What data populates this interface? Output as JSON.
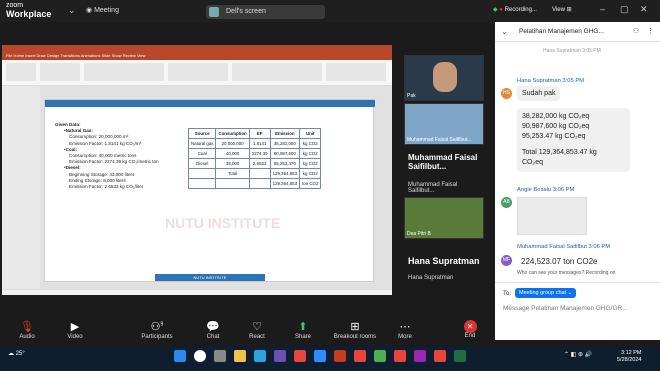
{
  "app": {
    "brand_top": "zoom",
    "brand_bottom": "Workplace",
    "meeting_label": "Meeting"
  },
  "share_bar": {
    "label": "Dell's screen"
  },
  "status": {
    "recording": "Recording...",
    "view": "View"
  },
  "slide": {
    "given_title": "Given Data:",
    "natural_gas": {
      "title": "•Natural Gas:",
      "consumption": "Consumption: 20,000,000 m³",
      "ef": "Emission Factor: 1.8141 kg CO₂/m³"
    },
    "coal": {
      "title": "•Coal:",
      "consumption": "Consumption: 40,000 metric tons",
      "ef": "Emission Factor: 2274.39 kg CO₂/metric ton"
    },
    "diesel": {
      "title": "•Diesel:",
      "beginning": "Beginning Storage: 43,000 liters",
      "ending": "Ending Storage: 8,000 liters",
      "ef": "Emission Factor: 2.6533 kg CO₂/liter"
    },
    "table": {
      "headers": [
        "Source",
        "Consumption",
        "EF",
        "Emission",
        "Unit"
      ],
      "rows": [
        [
          "Natural gas",
          "20,000,000",
          "1.8141",
          "36,282,000",
          "kg CO2"
        ],
        [
          "Coal",
          "40,000",
          "2274.39",
          "90,987,600",
          "kg CO2"
        ],
        [
          "Diesel",
          "35,000",
          "2.6533",
          "95,253,470",
          "kg CO2"
        ],
        [
          "",
          "Total",
          "",
          "129,364,853",
          "kg CO2"
        ],
        [
          "",
          "",
          "",
          "129,364,853",
          "ton CO2"
        ]
      ]
    },
    "footer": "NUTU INSTITUTE"
  },
  "gallery": {
    "tile1_name": "Pak",
    "tile2_name": "Muhammad Faisal Saifilbut...",
    "big_name1": "Muhammad Faisal Saifilbut...",
    "sub_name1": "Muhammad Faisal Saifilbut...",
    "tile3_name": "Dea Pitri B",
    "big_name2": "Hana Supratman",
    "sub_name2": "Hana Supratman"
  },
  "chat": {
    "title": "Pelatihan Manajemen GHG...",
    "thread_hint": "Hana Supratman 3:05 PM",
    "messages": [
      {
        "avatar": "HS",
        "name": "Hana Supratman 3:05 PM",
        "text": "Sudah pak"
      },
      {
        "lines": [
          "38,282,000 kg CO₂eq",
          "90,987,600 kg CO₂eq",
          "95,253.47 kg CO₂eq",
          "",
          "Total 129,364,853.47 kg",
          "CO₂eq"
        ]
      },
      {
        "avatar": "AB",
        "name": "Angie Bosalu 3:06 PM"
      },
      {
        "avatar": "MF",
        "name": "Muhammad Faisal Saifilbut 3:06 PM",
        "text": "224,523.07 ton CO2e"
      }
    ],
    "who_sees": "Who can see your messages? Recording on",
    "to_label": "To:",
    "to_value": "Meeting group chat",
    "placeholder": "Message Pelatihan Manajemen GHG/GR..."
  },
  "toolbar": {
    "audio": "Audio",
    "video": "Video",
    "participants": "Participants",
    "participants_count": "9",
    "chat": "Chat",
    "react": "React",
    "share": "Share",
    "breakout": "Breakout rooms",
    "more": "More",
    "end": "End"
  },
  "taskbar": {
    "temp": "25°",
    "time": "3:12 PM",
    "date": "5/28/2024"
  }
}
